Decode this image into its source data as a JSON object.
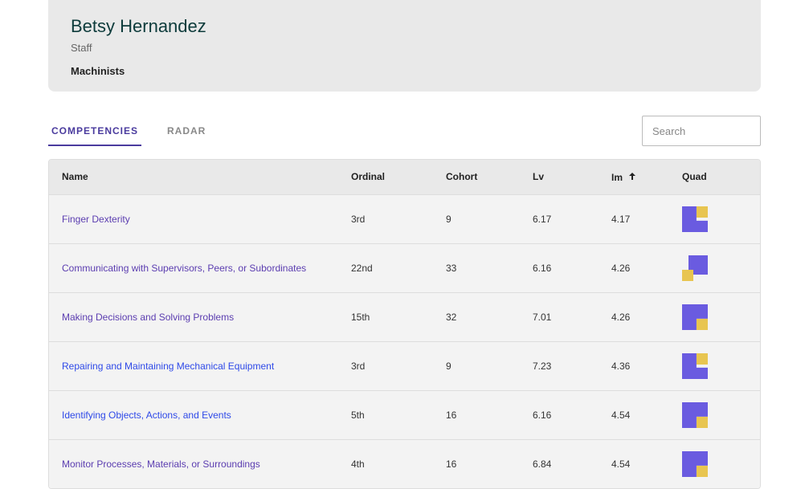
{
  "header": {
    "name": "Betsy Hernandez",
    "role": "Staff",
    "category": "Machinists"
  },
  "tabs": {
    "competencies": "COMPETENCIES",
    "radar": "RADAR"
  },
  "search": {
    "placeholder": "Search"
  },
  "table": {
    "columns": {
      "name": "Name",
      "ordinal": "Ordinal",
      "cohort": "Cohort",
      "lv": "Lv",
      "im": "Im",
      "quad": "Quad"
    },
    "sort": {
      "column": "im",
      "direction": "asc"
    },
    "rows": [
      {
        "name": "Finger Dexterity",
        "ordinal": "3rd",
        "cohort": "9",
        "lv": "6.17",
        "im": "4.17",
        "quad_variant": "L",
        "link_color": "purple"
      },
      {
        "name": "Communicating with Supervisors, Peers, or Subordinates",
        "ordinal": "22nd",
        "cohort": "33",
        "lv": "6.16",
        "im": "4.26",
        "quad_variant": "corner",
        "link_color": "purple"
      },
      {
        "name": "Making Decisions and Solving Problems",
        "ordinal": "15th",
        "cohort": "32",
        "lv": "7.01",
        "im": "4.26",
        "quad_variant": "yr",
        "link_color": "purple"
      },
      {
        "name": "Repairing and Maintaining Mechanical Equipment",
        "ordinal": "3rd",
        "cohort": "9",
        "lv": "7.23",
        "im": "4.36",
        "quad_variant": "L",
        "link_color": "blue"
      },
      {
        "name": "Identifying Objects, Actions, and Events",
        "ordinal": "5th",
        "cohort": "16",
        "lv": "6.16",
        "im": "4.54",
        "quad_variant": "yr",
        "link_color": "blue"
      },
      {
        "name": "Monitor Processes, Materials, or Surroundings",
        "ordinal": "4th",
        "cohort": "16",
        "lv": "6.84",
        "im": "4.54",
        "quad_variant": "yr",
        "link_color": "purple"
      }
    ]
  }
}
